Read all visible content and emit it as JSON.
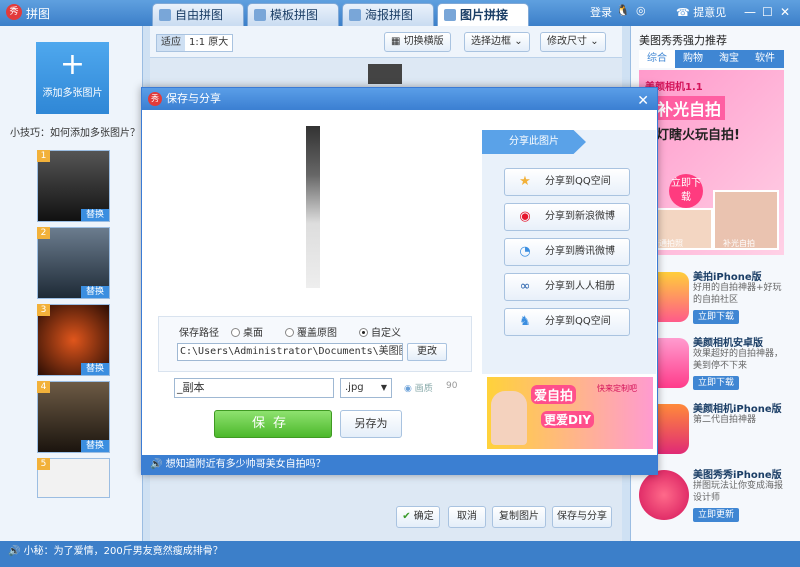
{
  "app": {
    "title": "拼图",
    "logo": "秀"
  },
  "tabs": [
    {
      "label": "自由拼图",
      "icon": "free-collage-icon"
    },
    {
      "label": "模板拼图",
      "icon": "template-collage-icon"
    },
    {
      "label": "海报拼图",
      "icon": "poster-collage-icon"
    },
    {
      "label": "图片拼接",
      "icon": "image-stitch-icon",
      "active": true
    }
  ],
  "topright": {
    "login": "登录",
    "feedback": "提意见"
  },
  "left": {
    "add_label": "添加多张图片",
    "tip": "小技巧：如何添加多张图片？",
    "thumbs": [
      {
        "num": "1",
        "replace": "替换"
      },
      {
        "num": "2",
        "replace": "替换"
      },
      {
        "num": "3",
        "replace": "替换"
      },
      {
        "num": "4",
        "replace": "替换"
      },
      {
        "num": "5",
        "replace": ""
      }
    ]
  },
  "toolbar": {
    "fit": "适应",
    "original": "1:1 原大",
    "switch_layout": "切换横版",
    "select_border": "选择边框",
    "resize": "修改尺寸"
  },
  "bottom": {
    "confirm": "确定",
    "cancel": "取消",
    "copy": "复制图片",
    "save_share": "保存与分享"
  },
  "right": {
    "title": "美图秀秀强力推荐",
    "tabs": [
      "综合",
      "购物",
      "淘宝",
      "软件"
    ],
    "banner": {
      "brand": "美颜相机1.1",
      "slogan1": "补光自拍",
      "slogan2": "黑灯瞎火玩自拍!",
      "download": "立即下载",
      "cap1": "普通拍照",
      "cap2": "补光自拍"
    },
    "items": [
      {
        "name": "美拍iPhone版",
        "desc": "好用的自拍神器+好玩的自拍社区",
        "btn": "立即下载"
      },
      {
        "name": "美颜相机安卓版",
        "desc": "效果超好的自拍神器，美到停不下来",
        "btn": "立即下载"
      },
      {
        "name": "美颜相机iPhone版",
        "desc": "第二代自拍神器",
        "btn": ""
      },
      {
        "name": "美图秀秀iPhone版",
        "desc": "拼图玩法让你变成海报设计师",
        "btn": "立即更新"
      }
    ]
  },
  "status": {
    "text": "小秘：为了爱情，200斤男友竟然瘦成排骨？"
  },
  "dialog": {
    "title": "保存与分享",
    "path_label": "保存路径",
    "radio_desktop": "桌面",
    "radio_overwrite": "覆盖原图",
    "radio_custom": "自定义",
    "path_value": "C:\\Users\\Administrator\\Documents\\美图图库",
    "change": "更改",
    "filename": "_副本",
    "ext": ".jpg",
    "quality_label": "画质",
    "quality_value": "90",
    "save": "保存",
    "save_as": "另存为",
    "status": "想知道附近有多少帅哥美女自拍吗？",
    "share_header": "分享此图片",
    "share": [
      {
        "label": "分享到QQ空间",
        "icon": "qzone-star-icon"
      },
      {
        "label": "分享到新浪微博",
        "icon": "sina-weibo-icon"
      },
      {
        "label": "分享到腾讯微博",
        "icon": "tencent-weibo-icon"
      },
      {
        "label": "分享到人人相册",
        "icon": "renren-icon"
      },
      {
        "label": "分享到QQ空间",
        "icon": "qq-penguin-icon"
      }
    ],
    "ad": {
      "t1": "爱自拍",
      "t2": "更爱DIY",
      "t3": "快来定制吧"
    }
  }
}
